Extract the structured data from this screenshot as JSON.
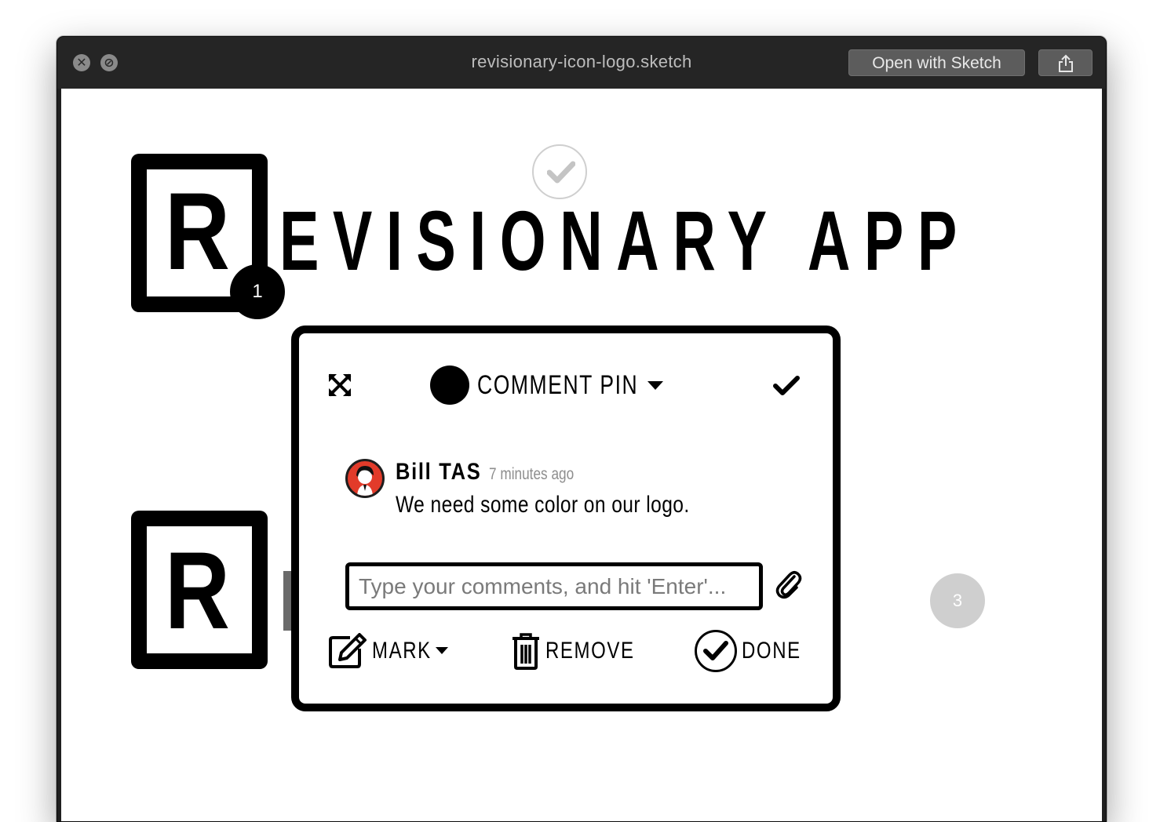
{
  "window": {
    "title": "revisionary-icon-logo.sketch",
    "open_button_label": "Open with Sketch",
    "close_glyph": "✕",
    "minimize_glyph": "⊘",
    "share_icon": "share-icon"
  },
  "canvas": {
    "logo1": {
      "letter": "R",
      "wordmark": "EVISIONARY APP"
    },
    "logo2": {
      "letter": "R"
    },
    "pins": [
      {
        "number": "1",
        "color": "#000000"
      },
      {
        "number": "3",
        "color": "#cfcfcf"
      }
    ]
  },
  "popup": {
    "pin_type_label": "COMMENT PIN",
    "comment": {
      "author": "Bill TAS",
      "time": "7 minutes ago",
      "text": "We need some color on our logo."
    },
    "input_placeholder": "Type your comments, and hit 'Enter'...",
    "actions": {
      "mark_label": "MARK",
      "remove_label": "REMOVE",
      "done_label": "DONE"
    }
  },
  "colors": {
    "titlebar": "#252525",
    "avatar_background": "#e23b2a",
    "muted_pin": "#cfcfcf"
  }
}
